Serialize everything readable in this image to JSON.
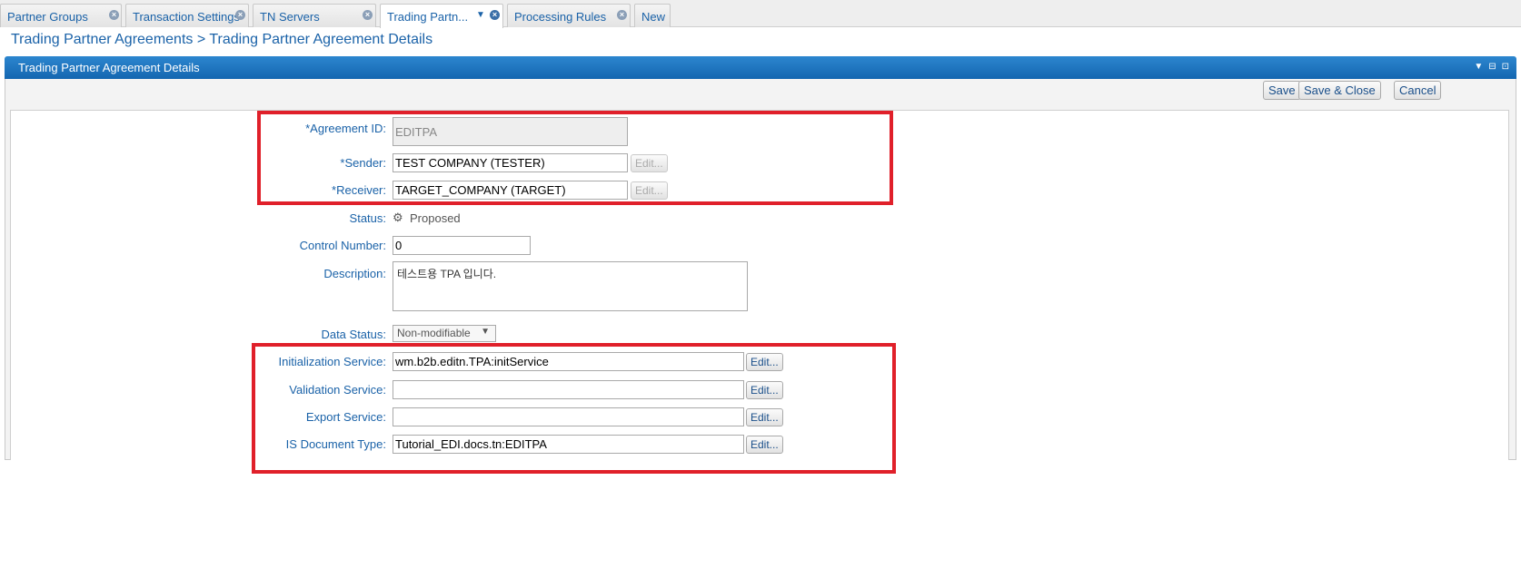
{
  "tabs": [
    {
      "label": "Partner Groups"
    },
    {
      "label": "Transaction Settings"
    },
    {
      "label": "TN Servers"
    },
    {
      "label": "Trading Partn..."
    },
    {
      "label": "Processing Rules"
    },
    {
      "label": "New"
    }
  ],
  "breadcrumb": {
    "parent": "Trading Partner Agreements",
    "separator": ">",
    "current": "Trading Partner Agreement Details"
  },
  "panel": {
    "title": "Trading Partner Agreement Details"
  },
  "toolbar": {
    "save": "Save",
    "save_close": "Save & Close",
    "cancel": "Cancel"
  },
  "form": {
    "agreement_id": {
      "label": "*Agreement ID:",
      "value": "EDITPA"
    },
    "sender": {
      "label": "*Sender:",
      "value": "TEST COMPANY (TESTER)",
      "edit": "Edit..."
    },
    "receiver": {
      "label": "*Receiver:",
      "value": "TARGET_COMPANY (TARGET)",
      "edit": "Edit..."
    },
    "status": {
      "label": "Status:",
      "value": "Proposed"
    },
    "control_number": {
      "label": "Control Number:",
      "value": "0"
    },
    "description": {
      "label": "Description:",
      "value": "테스트용 TPA 입니다."
    },
    "data_status": {
      "label": "Data Status:",
      "value": "Non-modifiable"
    },
    "init_service": {
      "label": "Initialization Service:",
      "value": "wm.b2b.editn.TPA:initService",
      "edit": "Edit..."
    },
    "validation_service": {
      "label": "Validation Service:",
      "value": "",
      "edit": "Edit..."
    },
    "export_service": {
      "label": "Export Service:",
      "value": "",
      "edit": "Edit..."
    },
    "is_doc_type": {
      "label": "IS Document Type:",
      "value": "Tutorial_EDI.docs.tn:EDITPA",
      "edit": "Edit..."
    }
  },
  "colors": {
    "accent": "#1a62a8",
    "header": "#1b74be",
    "highlight": "#e0202a"
  }
}
